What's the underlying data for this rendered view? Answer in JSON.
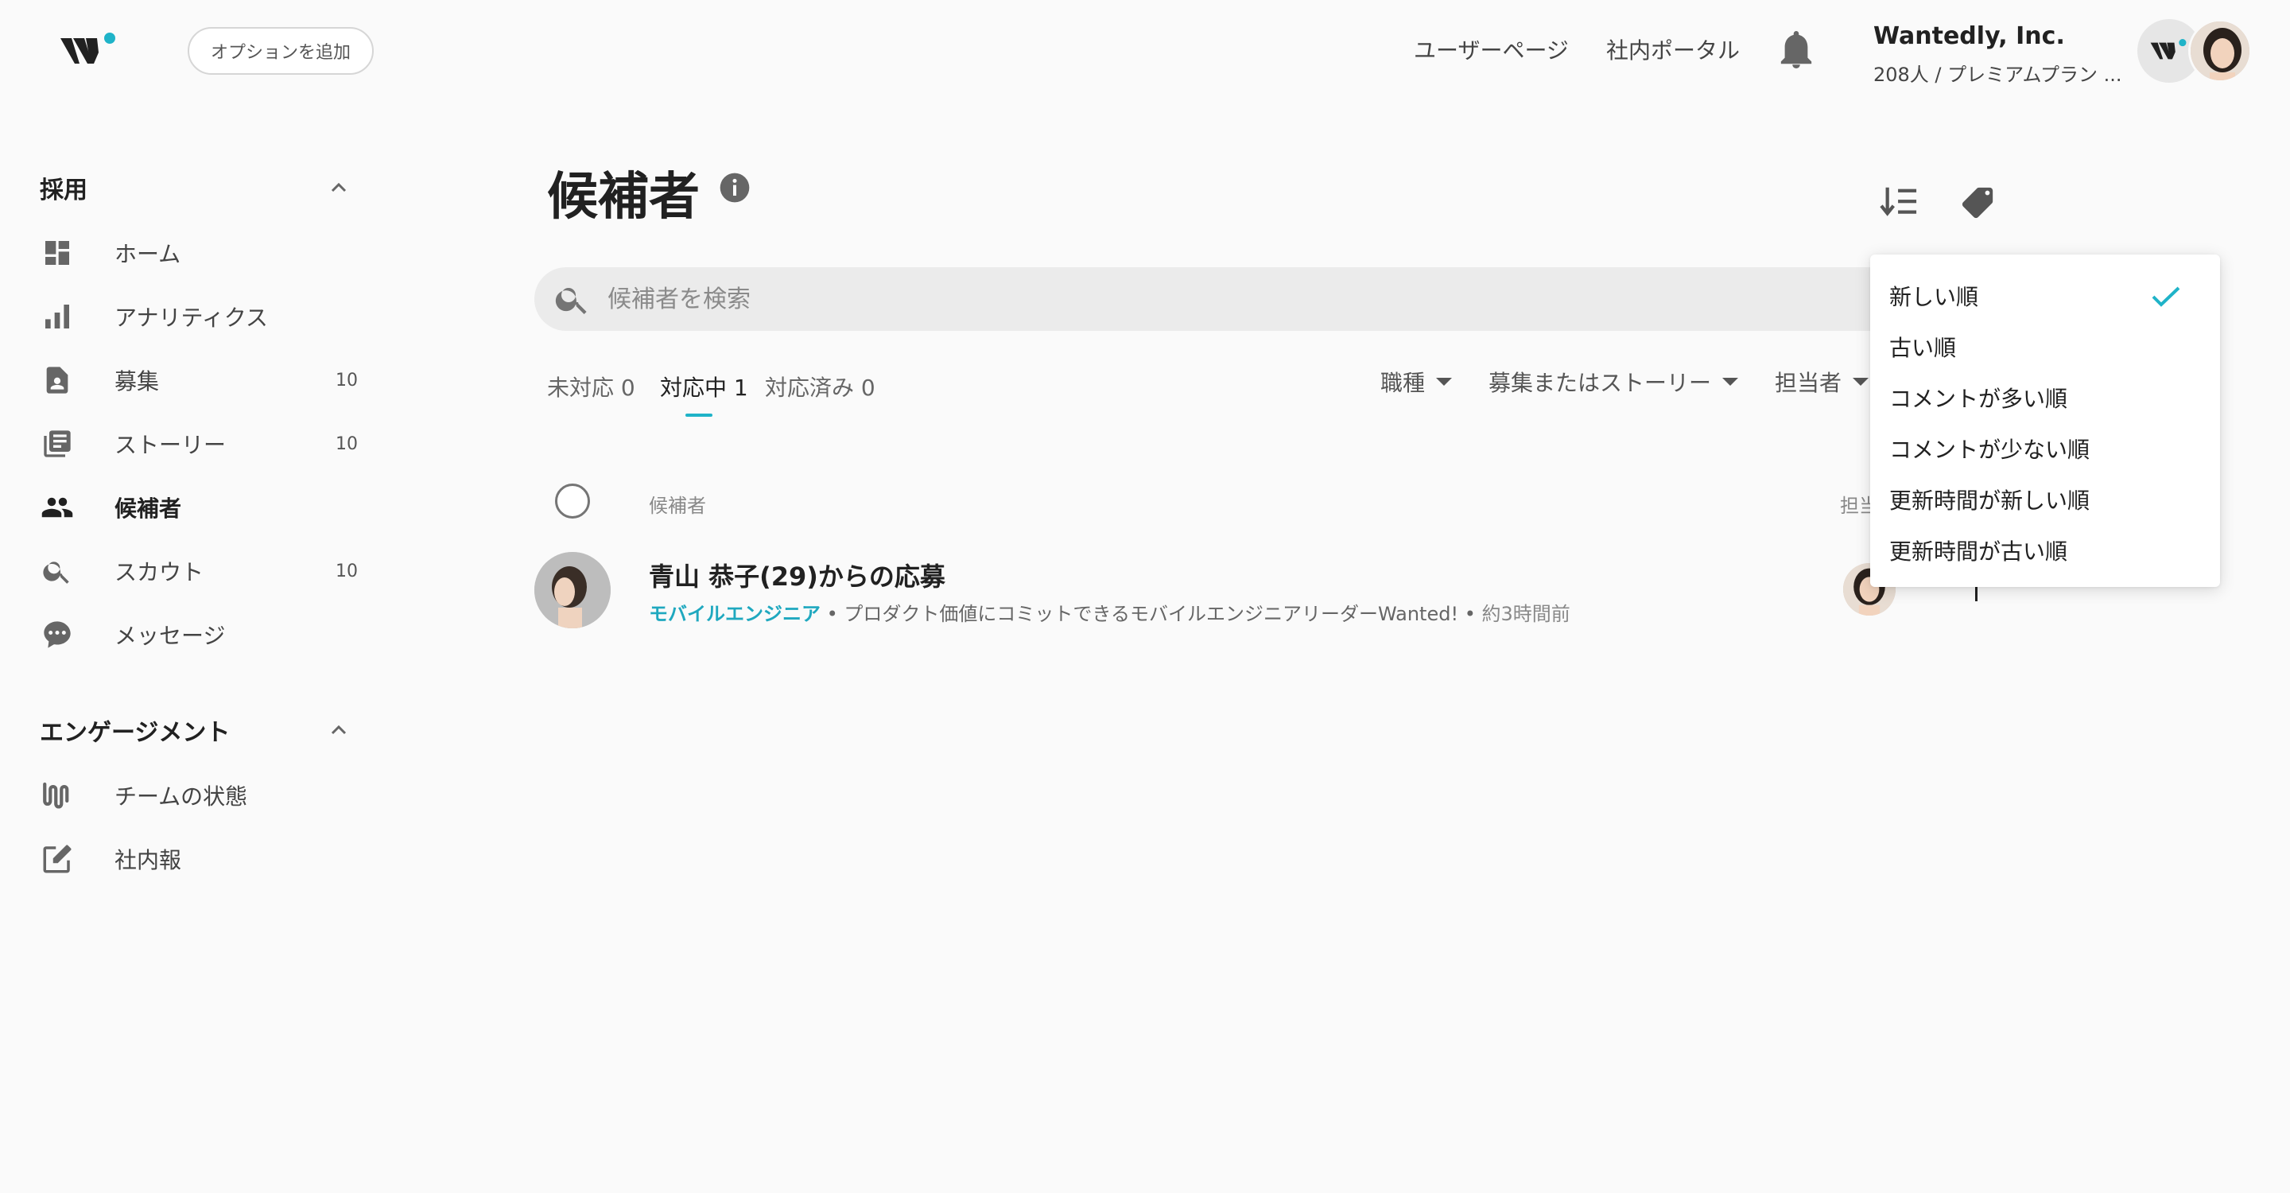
{
  "header": {
    "add_option_label": "オプションを追加",
    "links": {
      "user_page": "ユーザーページ",
      "portal": "社内ポータル"
    },
    "company": {
      "name": "Wantedly, Inc.",
      "plan": "208人 / プレミアムプラン ..."
    },
    "accent_color": "#1fb3c8"
  },
  "sidebar": {
    "sections": [
      {
        "title": "採用",
        "items": [
          {
            "label": "ホーム",
            "icon": "dashboard-icon",
            "count": ""
          },
          {
            "label": "アナリティクス",
            "icon": "bar-chart-icon",
            "count": ""
          },
          {
            "label": "募集",
            "icon": "job-post-icon",
            "count": "10"
          },
          {
            "label": "ストーリー",
            "icon": "story-icon",
            "count": "10"
          },
          {
            "label": "候補者",
            "icon": "people-icon",
            "count": "",
            "active": true
          },
          {
            "label": "スカウト",
            "icon": "search-icon",
            "count": "10"
          },
          {
            "label": "メッセージ",
            "icon": "chat-bubble-icon",
            "count": ""
          }
        ]
      },
      {
        "title": "エンゲージメント",
        "items": [
          {
            "label": "チームの状態",
            "icon": "pulse-icon",
            "count": ""
          },
          {
            "label": "社内報",
            "icon": "edit-icon",
            "count": ""
          }
        ]
      }
    ]
  },
  "main": {
    "title": "候補者",
    "search": {
      "placeholder": "候補者を検索",
      "value": ""
    },
    "status_tabs": [
      {
        "label": "未対応 0"
      },
      {
        "label": "対応中 1",
        "active": true
      },
      {
        "label": "対応済み 0"
      }
    ],
    "filters": [
      {
        "label": "職種"
      },
      {
        "label": "募集またはストーリー"
      },
      {
        "label": "担当者"
      }
    ],
    "table": {
      "columns": {
        "candidate": "候補者",
        "assignee": "担当"
      },
      "rows": [
        {
          "title": "青山 恭子(29)からの応募",
          "job": "モバイルエンジニア",
          "separator": " • ",
          "post": "プロダクト価値にコミットできるモバイルエンジニアリーダーWanted!",
          "time": "約3時間前"
        }
      ]
    }
  },
  "sort_dropdown": {
    "options": [
      {
        "label": "新しい順",
        "selected": true
      },
      {
        "label": "古い順"
      },
      {
        "label": "コメントが多い順"
      },
      {
        "label": "コメントが少ない順"
      },
      {
        "label": "更新時間が新しい順"
      },
      {
        "label": "更新時間が古い順"
      }
    ]
  }
}
